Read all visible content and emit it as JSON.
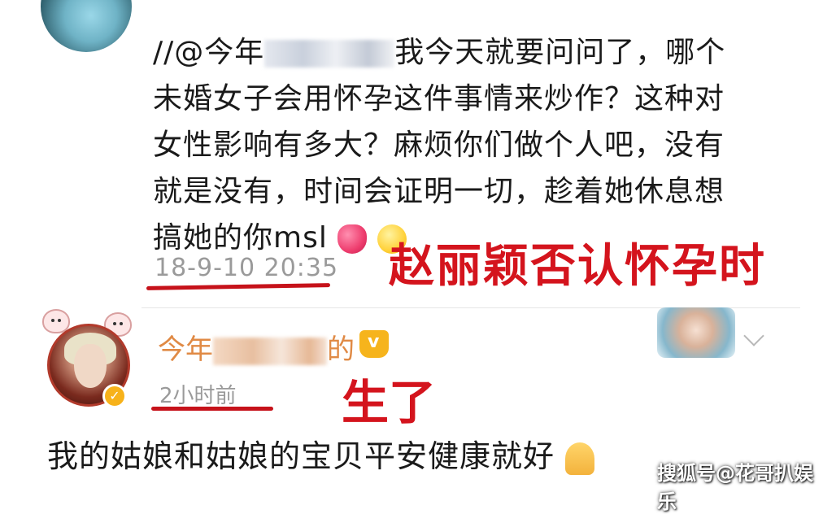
{
  "quote_comment": {
    "text_prefix": "//@今年",
    "text_body_line1": "我今天就要问问了，哪个",
    "text_body_line2": "未婚女子会用怀孕这件事情来炒作？这种对",
    "text_body_line3": "女性影响有多大？麻烦你们做个人吧，没有",
    "text_body_line4": "就是没有，时间会证明一切，趁着她休息想",
    "text_body_line5": "搞她的你msl",
    "timestamp": "18-9-10 20:35",
    "annotation": "赵丽颖否认怀孕时",
    "emojis": [
      "heart-emoji",
      "grin-emoji"
    ]
  },
  "reply": {
    "username_prefix": "今年",
    "username_suffix": "的",
    "time_ago": "2小时前",
    "annotation": "生了",
    "text": "我的姑娘和姑娘的宝贝平安健康就好",
    "emoji": "pray-emoji",
    "badges": [
      "verified-badge",
      "crown-icon"
    ]
  },
  "watermark": "搜狐号@花哥扒娱乐",
  "colors": {
    "annotation_red": "#d4141d",
    "username_orange": "#e08a45",
    "meta_gray": "#9a9a9a"
  }
}
